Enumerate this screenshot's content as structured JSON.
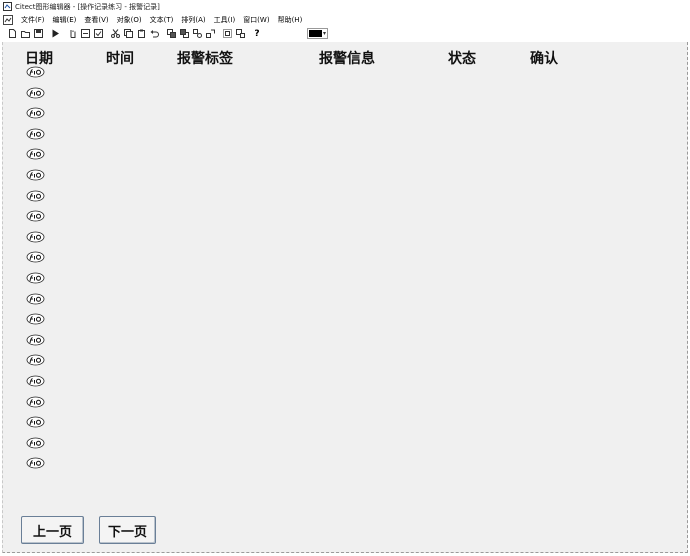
{
  "window": {
    "title": "Citect图形编辑器 - [操作记录练习 - 报警记录]"
  },
  "menu": {
    "items": [
      "文件(F)",
      "编辑(E)",
      "查看(V)",
      "对象(O)",
      "文本(T)",
      "排列(A)",
      "工具(I)",
      "窗口(W)",
      "帮助(H)"
    ]
  },
  "toolbar": {
    "icons": [
      "new-icon",
      "open-icon",
      "save-icon",
      "play-icon",
      "hand-icon",
      "save-as-icon",
      "checkbox-icon",
      "cut-icon",
      "copy-icon",
      "paste-icon",
      "undo-icon",
      "bring-front-icon",
      "send-back-icon",
      "group-icon",
      "ungroup-icon",
      "align-icon",
      "resize-icon"
    ],
    "help_label": "?",
    "color_value": "#000000"
  },
  "table": {
    "headers": [
      "日期",
      "时间",
      "报警标签",
      "报警信息",
      "状态",
      "确认"
    ],
    "row_count": 20,
    "row_icon": "genie-object-icon"
  },
  "buttons": {
    "prev_label": "上一页",
    "next_label": "下一页"
  }
}
